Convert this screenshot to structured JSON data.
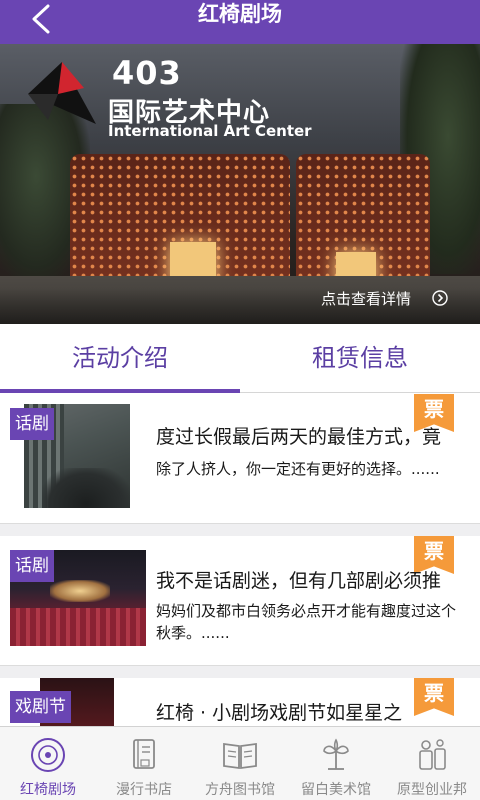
{
  "header": {
    "title": "红椅剧场",
    "accent_color": "#6a45b3"
  },
  "banner": {
    "logo_number": "403",
    "name_cn": "国际艺术中心",
    "name_en": "International Art Center",
    "detail_link": "点击查看详情"
  },
  "tabs": [
    {
      "label": "活动介绍",
      "active": true
    },
    {
      "label": "租赁信息",
      "active": false
    }
  ],
  "events": [
    {
      "tag": "话剧",
      "ticket": "票",
      "title": "度过长假最后两天的最佳方式，竟",
      "description": "除了人挤人，你一定还有更好的选择。......"
    },
    {
      "tag": "话剧",
      "ticket": "票",
      "title": "我不是话剧迷，但有几部剧必须推",
      "description": "妈妈们及都市白领务必点开才能有趣度过这个秋季。......"
    },
    {
      "tag": "戏剧节",
      "ticket": "票",
      "title": "红椅 · 小剧场戏剧节如星星之",
      "description": ""
    }
  ],
  "ticket_color": "#f59a3a",
  "bottom_nav": [
    {
      "label": "红椅剧场",
      "icon": "disc-icon",
      "active": true
    },
    {
      "label": "漫行书店",
      "icon": "book-icon",
      "active": false
    },
    {
      "label": "方舟图书馆",
      "icon": "open-book-icon",
      "active": false
    },
    {
      "label": "留白美术馆",
      "icon": "plant-icon",
      "active": false
    },
    {
      "label": "原型创业邦",
      "icon": "figures-icon",
      "active": false
    }
  ]
}
